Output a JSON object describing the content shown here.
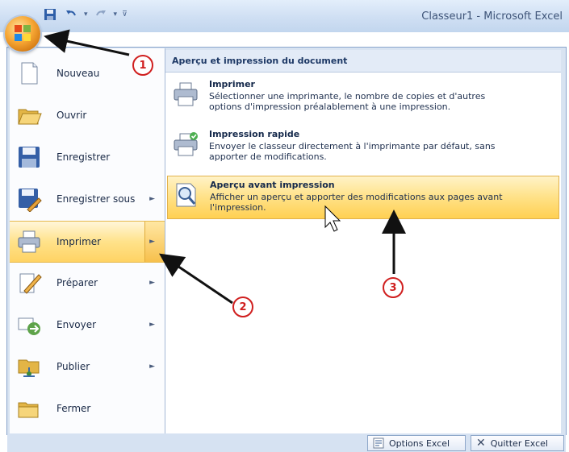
{
  "window": {
    "title": "Classeur1 - Microsoft Excel"
  },
  "qat": {
    "items": [
      "save-icon",
      "undo-icon",
      "redo-icon"
    ]
  },
  "menu": {
    "left_items": [
      {
        "label": "Nouveau",
        "has_submenu": false,
        "selected": false,
        "icon": "new-document-icon"
      },
      {
        "label": "Ouvrir",
        "has_submenu": false,
        "selected": false,
        "icon": "open-folder-icon"
      },
      {
        "label": "Enregistrer",
        "has_submenu": false,
        "selected": false,
        "icon": "save-disk-icon"
      },
      {
        "label": "Enregistrer sous",
        "has_submenu": true,
        "selected": false,
        "icon": "save-as-icon"
      },
      {
        "label": "Imprimer",
        "has_submenu": true,
        "selected": true,
        "icon": "printer-icon"
      },
      {
        "label": "Préparer",
        "has_submenu": true,
        "selected": false,
        "icon": "prepare-pen-icon"
      },
      {
        "label": "Envoyer",
        "has_submenu": true,
        "selected": false,
        "icon": "send-icon"
      },
      {
        "label": "Publier",
        "has_submenu": true,
        "selected": false,
        "icon": "publish-icon"
      },
      {
        "label": "Fermer",
        "has_submenu": false,
        "selected": false,
        "icon": "close-folder-icon"
      }
    ],
    "submenu_title": "Aperçu et impression du document",
    "submenu_items": [
      {
        "title": "Imprimer",
        "desc1": "Sélectionner une imprimante, le nombre de copies et d'autres",
        "desc2": "options d'impression préalablement à une impression.",
        "icon": "printer-icon",
        "selected": false
      },
      {
        "title": "Impression rapide",
        "desc1": "Envoyer le classeur directement à l'imprimante par défaut, sans",
        "desc2": "apporter de modifications.",
        "icon": "quick-print-icon",
        "selected": false
      },
      {
        "title": "Aperçu avant impression",
        "desc1": "Afficher un aperçu et apporter des modifications aux pages avant",
        "desc2": "l'impression.",
        "icon": "print-preview-icon",
        "selected": true
      }
    ]
  },
  "footer": {
    "options_label": "Options Excel",
    "quit_label": "Quitter Excel"
  },
  "callouts": [
    "1",
    "2",
    "3"
  ],
  "colors": {
    "callout": "#d01f1f",
    "highlight": "#ffd364"
  }
}
